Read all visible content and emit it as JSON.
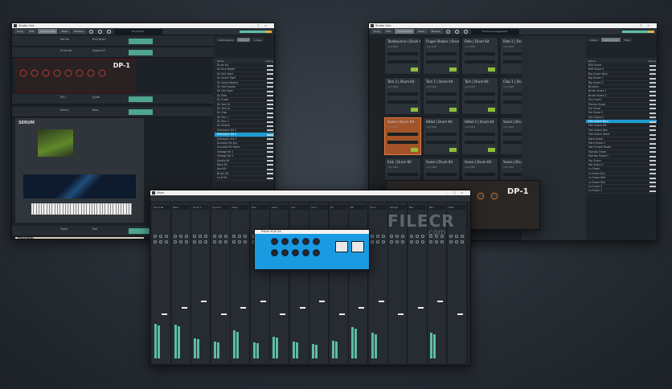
{
  "left_window": {
    "title": "Studio One",
    "toolbar": [
      "Song",
      "Edit",
      "Instruments",
      "Mixer",
      "Browse"
    ],
    "display": "Drums 01",
    "tracks": [
      {
        "name": "Mai Tai",
        "input": "Kick Drum"
      },
      {
        "name": "Drum Kit",
        "input": "Impact XT"
      },
      {
        "name": "DP-1",
        "input": "Synth"
      },
      {
        "name": "Serum",
        "input": "Bass"
      },
      {
        "name": "Thorn",
        "input": "Pad"
      }
    ],
    "plugin_dp1": "DP-1",
    "plugin_serum": "SERUM",
    "plugin_thorn": "THORN",
    "browser": {
      "tabs": [
        "Instruments",
        "Effects",
        "Loops"
      ],
      "header_name": "Name",
      "header_rating": "Rating",
      "items": [
        "Drum Kit",
        "DL Kick Bright",
        "DL Kick Dark",
        "DL Snare Tight",
        "DL Snare Roomy",
        "DL Hat Closed",
        "DL Hat Open",
        "DL Ride",
        "DL Crash",
        "DL Tom Hi",
        "DL Tom Lo",
        "DL Clap",
        "DL Perc 1",
        "DL Perc 2",
        "DL Shaker",
        "Electronic Kit 1",
        "Electronic Kit 2",
        "Electronic Kit 3",
        "Acoustic Kit Dry",
        "Acoustic Kit Room",
        "Vintage Kit 1",
        "Vintage Kit 2",
        "Studio Kit",
        "Rock Kit",
        "Jazz Kit",
        "Brush Kit",
        "Lo-Fi Kit"
      ],
      "selected": 16
    }
  },
  "right_window": {
    "title": "Studio One",
    "toolbar": [
      "Song",
      "Edit",
      "Instruments",
      "Mixer",
      "Browse"
    ],
    "display": "Drums Arrangement",
    "pads": [
      {
        "name": "Tambourine | Drum Kit",
        "bpm": "120 BPM"
      },
      {
        "name": "Finger Shaker | Drum",
        "bpm": "120 BPM"
      },
      {
        "name": "Ride | Drum Kit",
        "bpm": "120 BPM"
      },
      {
        "name": "Ride 2 | Drum Kit",
        "bpm": "120 BPM"
      },
      {
        "name": "Tom 2 | Drum Kit",
        "bpm": "120 BPM"
      },
      {
        "name": "Tom 1 | Drum Kit",
        "bpm": "120 BPM"
      },
      {
        "name": "Tom | Drum Kit",
        "bpm": "120 BPM"
      },
      {
        "name": "Clap 1 | Drum Kit",
        "bpm": "120 BPM"
      },
      {
        "name": "Snare | Drum Kit",
        "bpm": "120 BPM"
      },
      {
        "name": "HiHat | Drum Kit",
        "bpm": "120 BPM"
      },
      {
        "name": "HiHat 2 | Drum Kit",
        "bpm": "120 BPM"
      },
      {
        "name": "Snare | Drum Kit",
        "bpm": "120 BPM"
      },
      {
        "name": "Kick | Drum Kit",
        "bpm": "120 BPM"
      },
      {
        "name": "Snare | Drum Kit",
        "bpm": "120 BPM"
      },
      {
        "name": "Snare | Drum Kit",
        "bpm": "120 BPM"
      },
      {
        "name": "Snare | Drum Kit",
        "bpm": "120 BPM"
      }
    ],
    "selected_pad": 8,
    "browser": {
      "tabs": [
        "Loops",
        "Instruments",
        "Files"
      ],
      "header_name": "Name",
      "header_rating": "Rating",
      "items": [
        "808 Snare",
        "808 Snare 2",
        "Big Snare Verb",
        "Big Snare 1",
        "Big Snare 2",
        "Brushes",
        "Brush Snare 1",
        "Brush Snare 2",
        "Dry Snare",
        "Electro Snare",
        "Fat Snare",
        "Fat Snare 2",
        "Film Snare 1",
        "Film Snare Bury",
        "Film Snare Off",
        "Film Snare Rim",
        "Film Snare Stack",
        "Hard Snare",
        "Hard Snare 2",
        "Hard Snare Room",
        "HipHop Snare",
        "HipHop Snare 2",
        "Hip Snare",
        "Hip Snare 2",
        "Lo Snare",
        "Lo Snare Dry",
        "Lo Snare Wet",
        "Lo Snare Rim",
        "Lo Snare 3",
        "Lo Snare 4"
      ],
      "selected": 13
    }
  },
  "mixer_window": {
    "title": "Mixer",
    "channels": [
      {
        "name": "Drum Kit",
        "level": 0.62
      },
      {
        "name": "Bass",
        "level": 0.6
      },
      {
        "name": "Synth 1",
        "level": 0.35
      },
      {
        "name": "Synth 2",
        "level": 0.3
      },
      {
        "name": "Keys",
        "level": 0.5
      },
      {
        "name": "Pad",
        "level": 0.28
      },
      {
        "name": "Lead",
        "level": 0.38
      },
      {
        "name": "Vox",
        "level": 0.3
      },
      {
        "name": "Vox 2",
        "level": 0.25
      },
      {
        "name": "FX",
        "level": 0.32
      },
      {
        "name": "Gtr",
        "level": 0.55
      },
      {
        "name": "Gtr 2",
        "level": 0.45
      },
      {
        "name": "Strings",
        "level": 0.0
      },
      {
        "name": "Bus",
        "level": 0.0
      },
      {
        "name": "Perc",
        "level": 0.45
      },
      {
        "name": "Main",
        "level": 0.0
      }
    ]
  },
  "plugin_eq": {
    "title": "Pultec EQP-1A"
  },
  "plugin_dp1": {
    "title": "DP-1"
  },
  "watermark": "FILECR",
  "watermark_domain": ".com"
}
